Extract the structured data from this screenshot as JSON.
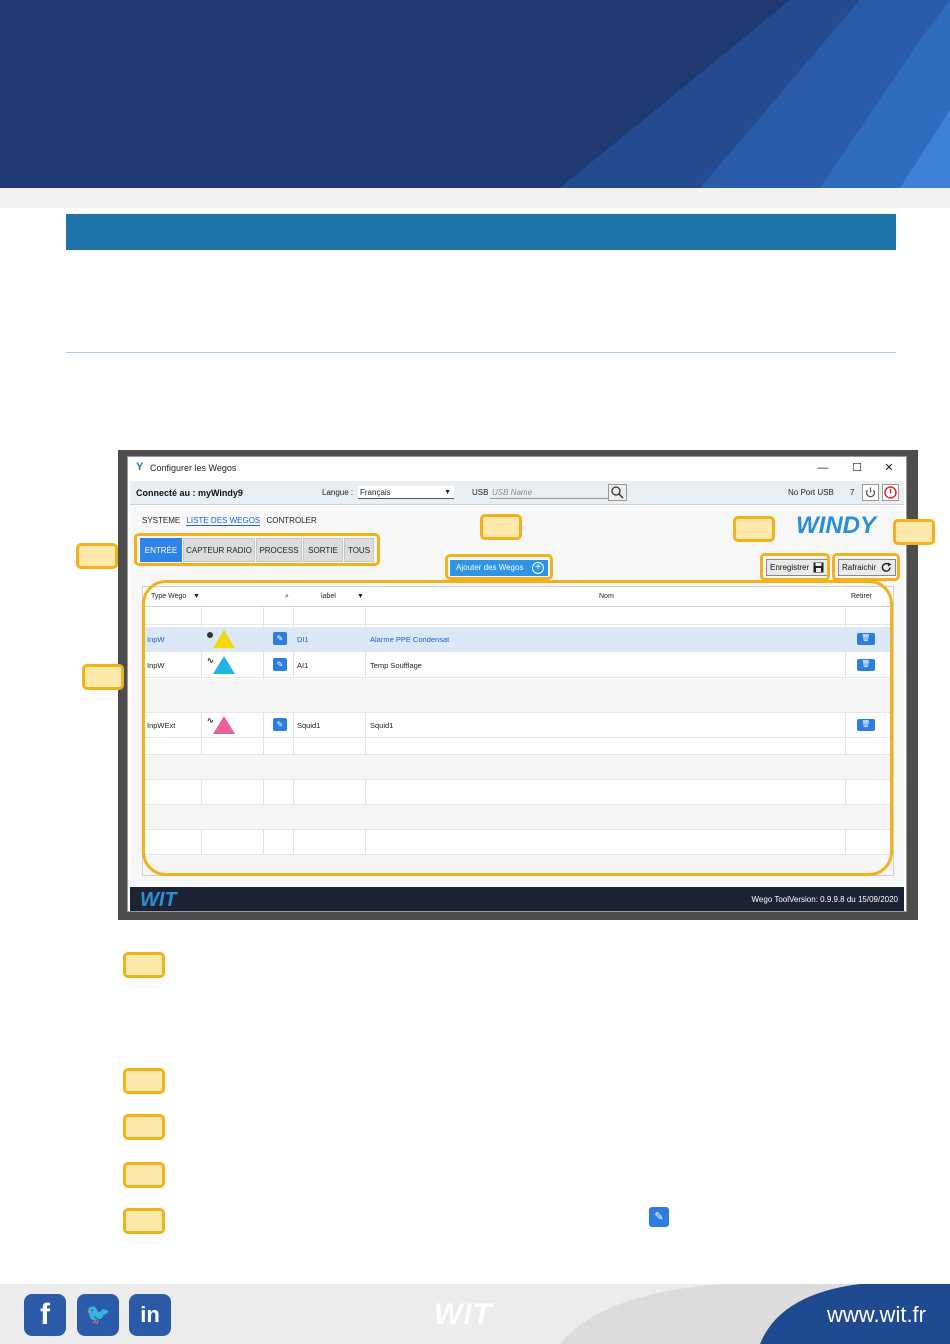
{
  "colors": {
    "banner_dark": "#1f3a73",
    "banner_mid": "#244b8f",
    "banner_light": "#2e6cc0",
    "section_bar": "#1e74a8",
    "callout_border": "#f2b21e",
    "callout_fill": "#fde9a9",
    "accent_blue": "#2d84e6"
  },
  "window": {
    "title": "Configurer les Wegos",
    "minimize": "—",
    "maximize": "☐",
    "close": "✕",
    "connected": "Connecté au : myWindy9",
    "lang_label": "Langue :",
    "lang_value": "Français",
    "usb_label": "USB",
    "usb_placeholder": "USB Name",
    "no_port": "No Port USB",
    "port_value": "7",
    "menu": [
      "SYSTEME",
      "LISTE DES WEGOS",
      "CONTROLER"
    ],
    "brand": "WINDY",
    "tabs": [
      "ENTRÉE",
      "CAPTEUR RADIO",
      "PROCESS",
      "SORTIE",
      "TOUS"
    ],
    "add_button": "Ajouter des Wegos",
    "save_button": "Enregistrer",
    "refresh_button": "Rafraichir",
    "columns": {
      "type": "Type Wego",
      "label": "label",
      "nom": "Nom",
      "retirer": "Retirer"
    },
    "rows": [
      {
        "type": "InpW",
        "label": "DI1",
        "nom": "Alarme PPE Condensat"
      },
      {
        "type": "InpW",
        "label": "AI1",
        "nom": "Temp Soufflage"
      },
      {
        "type": "InpWExt",
        "label": "Squid1",
        "nom": "Squid1"
      }
    ],
    "footer_brand": "WIT",
    "version": "Wego ToolVersion: 0.9.9.8 du 15/09/2020"
  },
  "footer": {
    "logo": "WIT",
    "url": "www.wit.fr",
    "social": [
      "f",
      "twitter",
      "in"
    ]
  }
}
